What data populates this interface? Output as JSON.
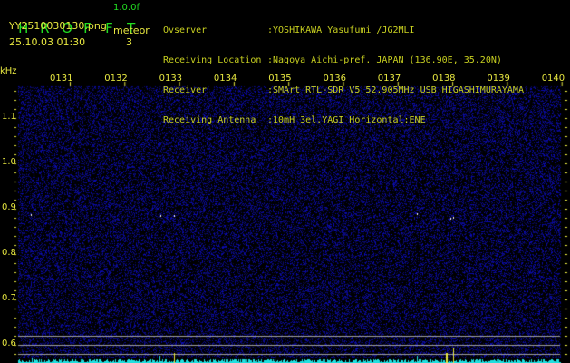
{
  "header": {
    "app_title_letters": [
      "H",
      "R",
      "O",
      "F",
      "F",
      "T"
    ],
    "version": "1.0.0f",
    "filename": "YY2510030130.png",
    "datetime": "25.10.03 01:30",
    "meteor_label": "meteor",
    "meteor_count": "3"
  },
  "info": [
    {
      "label": "Ovserver",
      "value": ":YOSHIKAWA Yasufumi /JG2MLI"
    },
    {
      "label": "Receiving Location",
      "value": ":Nagoya Aichi-pref. JAPAN (136.90E, 35.20N)"
    },
    {
      "label": "Receiver",
      "value": ":SMArt RTL-SDR V5 52.905MHz USB HIGASHIMURAYAMA"
    },
    {
      "label": "Receiving Antenna",
      "value": ":10mH 3el.YAGI Horizontal:ENE"
    }
  ],
  "spectrogram": {
    "y_unit": "kHz",
    "y_labels": [
      "1.1",
      "1.0",
      "0.9",
      "0.8",
      "0.7",
      "0.6"
    ],
    "time_labels": [
      "0131",
      "0132",
      "0133",
      "0134",
      "0135",
      "0136",
      "0137",
      "0138",
      "0139",
      "0140"
    ],
    "colors": {
      "noise": "#1a1aa0",
      "echo": "#ffffff",
      "axis": "#e8e840",
      "refline": "#a0a0a0",
      "histogram": "#20e0e0",
      "title": "#22dd22"
    }
  }
}
